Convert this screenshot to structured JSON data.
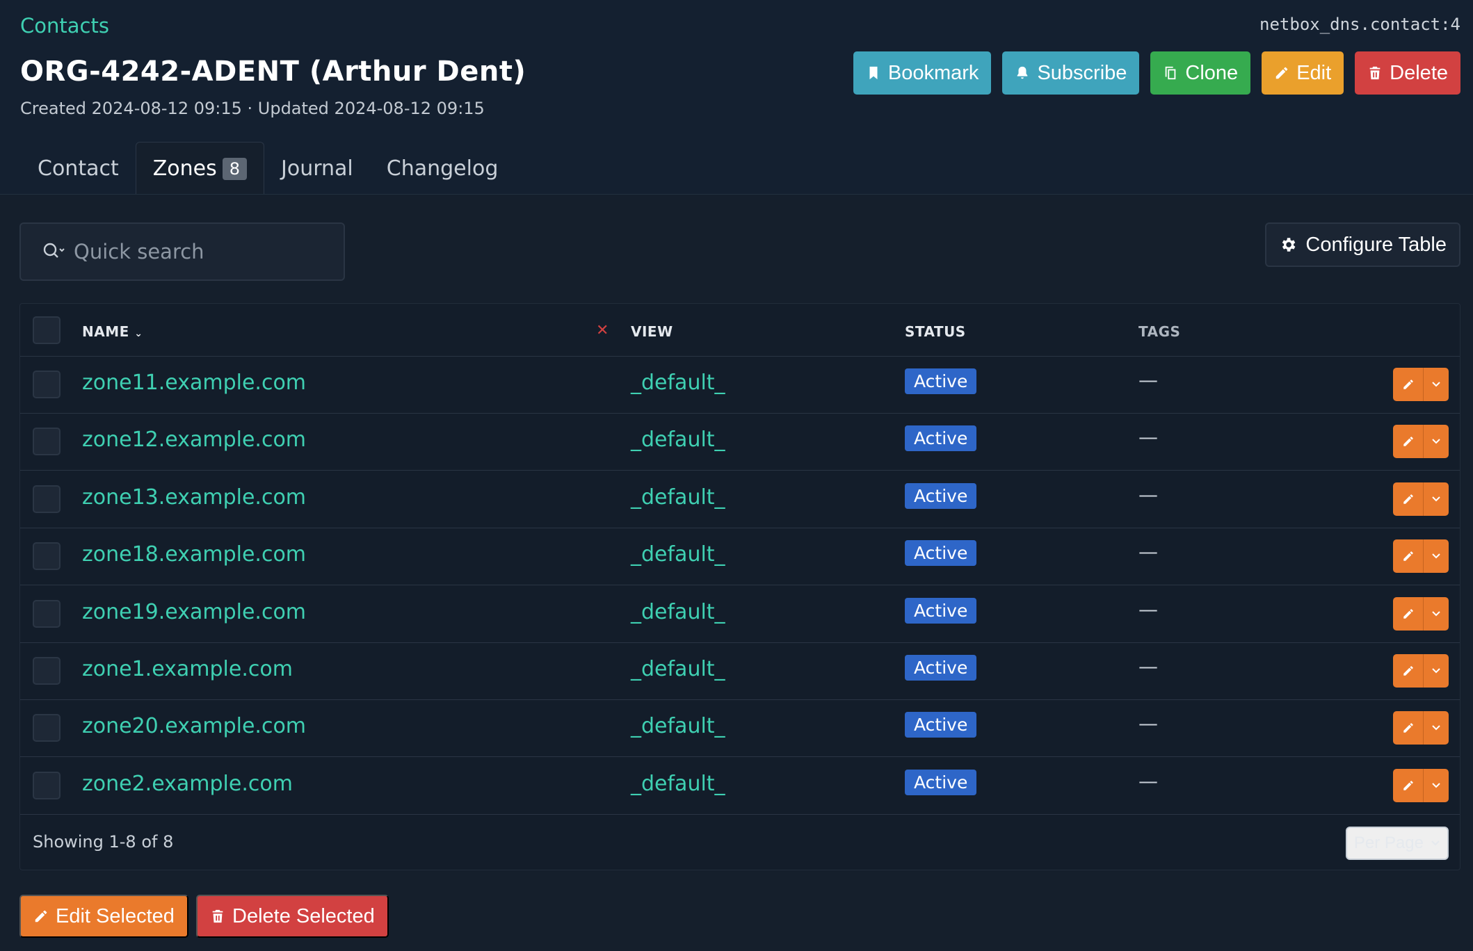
{
  "header": {
    "breadcrumb": "Contacts",
    "object_id": "netbox_dns.contact:4",
    "title": "ORG-4242-ADENT (Arthur Dent)",
    "timestamps": "Created 2024-08-12 09:15 · Updated 2024-08-12 09:15",
    "actions": {
      "bookmark": "Bookmark",
      "subscribe": "Subscribe",
      "clone": "Clone",
      "edit": "Edit",
      "delete": "Delete"
    }
  },
  "tabs": {
    "contact": "Contact",
    "zones": "Zones",
    "zones_count": "8",
    "journal": "Journal",
    "changelog": "Changelog"
  },
  "search": {
    "placeholder": "Quick search"
  },
  "configure_table": "Configure Table",
  "table": {
    "columns": {
      "name": "NAME",
      "view": "VIEW",
      "status": "STATUS",
      "tags": "TAGS"
    },
    "rows": [
      {
        "name": "zone11.example.com",
        "view": "_default_",
        "status": "Active",
        "tags": "—"
      },
      {
        "name": "zone12.example.com",
        "view": "_default_",
        "status": "Active",
        "tags": "—"
      },
      {
        "name": "zone13.example.com",
        "view": "_default_",
        "status": "Active",
        "tags": "—"
      },
      {
        "name": "zone18.example.com",
        "view": "_default_",
        "status": "Active",
        "tags": "—"
      },
      {
        "name": "zone19.example.com",
        "view": "_default_",
        "status": "Active",
        "tags": "—"
      },
      {
        "name": "zone1.example.com",
        "view": "_default_",
        "status": "Active",
        "tags": "—"
      },
      {
        "name": "zone20.example.com",
        "view": "_default_",
        "status": "Active",
        "tags": "—"
      },
      {
        "name": "zone2.example.com",
        "view": "_default_",
        "status": "Active",
        "tags": "—"
      }
    ],
    "showing": "Showing 1-8 of 8",
    "per_page": "Per Page"
  },
  "bulk_actions": {
    "edit_selected": "Edit Selected",
    "delete_selected": "Delete Selected"
  },
  "colors": {
    "background": "#151f2c",
    "link": "#3fd0b2",
    "status_active": "#2e66c8",
    "edit": "#ea7a2c",
    "delete": "#d24141"
  }
}
